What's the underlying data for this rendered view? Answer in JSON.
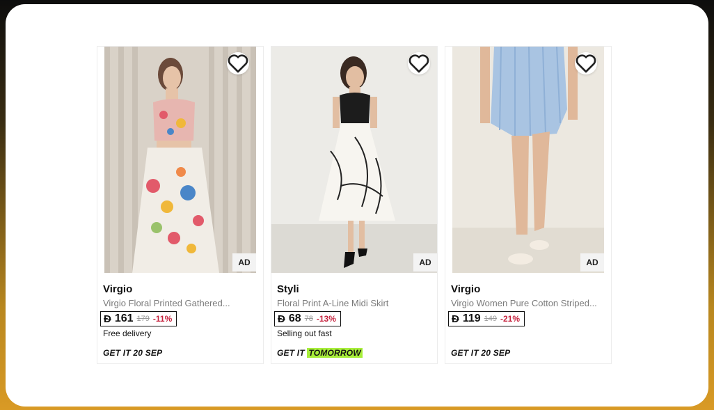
{
  "currency_symbol": "Đ",
  "products": [
    {
      "brand": "Virgio",
      "title": "Virgio Floral Printed Gathered...",
      "price": "161",
      "old_price": "179",
      "discount": "-11%",
      "note": "Free delivery",
      "ad_label": "AD",
      "delivery_prefix": "GET IT",
      "delivery_date": "20 SEP",
      "delivery_highlight": false
    },
    {
      "brand": "Styli",
      "title": "Floral Print A-Line Midi Skirt",
      "price": "68",
      "old_price": "78",
      "discount": "-13%",
      "note": "Selling out fast",
      "ad_label": "AD",
      "delivery_prefix": "GET IT",
      "delivery_date": "TOMORROW",
      "delivery_highlight": true
    },
    {
      "brand": "Virgio",
      "title": "Virgio Women Pure Cotton Striped...",
      "price": "119",
      "old_price": "149",
      "discount": "-21%",
      "note": "",
      "ad_label": "AD",
      "delivery_prefix": "GET IT",
      "delivery_date": "20 SEP",
      "delivery_highlight": false
    }
  ],
  "colors": {
    "discount": "#c6243f",
    "highlight": "#a7ee3a",
    "frame_border_top": "#0d0d0d",
    "frame_border_bottom": "#d99a25"
  },
  "icons": [
    "heart-outline-icon"
  ]
}
